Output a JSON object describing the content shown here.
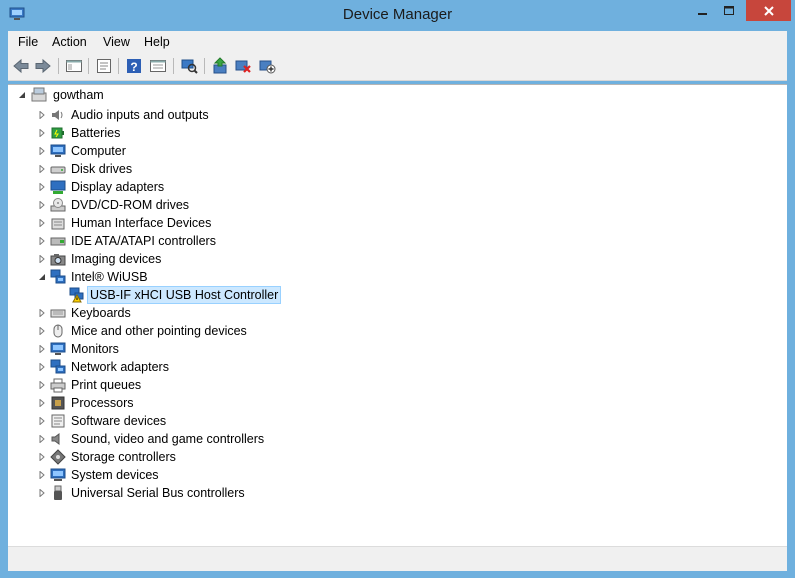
{
  "window": {
    "title": "Device Manager"
  },
  "menu": [
    "File",
    "Action",
    "View",
    "Help"
  ],
  "toolbar": [
    "back-icon",
    "forward-icon",
    "show-hide-tree-icon",
    "properties-icon",
    "help-icon",
    "view-icon",
    "scan-hardware-icon",
    "update-driver-icon",
    "uninstall-icon",
    "add-legacy-icon"
  ],
  "tree": {
    "root": {
      "label": "gowtham",
      "icon": "computer-icon"
    },
    "categories": [
      {
        "label": "Audio inputs and outputs",
        "icon": "speaker-icon"
      },
      {
        "label": "Batteries",
        "icon": "battery-icon"
      },
      {
        "label": "Computer",
        "icon": "monitor-icon"
      },
      {
        "label": "Disk drives",
        "icon": "disk-drive-icon"
      },
      {
        "label": "Display adapters",
        "icon": "display-adapter-icon"
      },
      {
        "label": "DVD/CD-ROM drives",
        "icon": "dvd-icon"
      },
      {
        "label": "Human Interface Devices",
        "icon": "hid-icon"
      },
      {
        "label": "IDE ATA/ATAPI controllers",
        "icon": "ide-icon"
      },
      {
        "label": "Imaging devices",
        "icon": "camera-icon"
      },
      {
        "label": "Intel® WiUSB",
        "icon": "network-icon",
        "expanded": true,
        "children": [
          {
            "label": "USB-IF xHCI USB Host Controller",
            "icon": "warning-device-icon",
            "selected": true
          }
        ]
      },
      {
        "label": "Keyboards",
        "icon": "keyboard-icon"
      },
      {
        "label": "Mice and other pointing devices",
        "icon": "mouse-icon"
      },
      {
        "label": "Monitors",
        "icon": "monitor-icon"
      },
      {
        "label": "Network adapters",
        "icon": "network-icon"
      },
      {
        "label": "Print queues",
        "icon": "printer-icon"
      },
      {
        "label": "Processors",
        "icon": "processor-icon"
      },
      {
        "label": "Software devices",
        "icon": "software-icon"
      },
      {
        "label": "Sound, video and game controllers",
        "icon": "sound-icon"
      },
      {
        "label": "Storage controllers",
        "icon": "storage-icon"
      },
      {
        "label": "System devices",
        "icon": "system-icon"
      },
      {
        "label": "Universal Serial Bus controllers",
        "icon": "usb-icon"
      }
    ]
  },
  "colors": {
    "frame": "#6fb0de",
    "close": "#c7463c",
    "selection_bg": "#cce8ff",
    "selection_border": "#99d1ff"
  }
}
